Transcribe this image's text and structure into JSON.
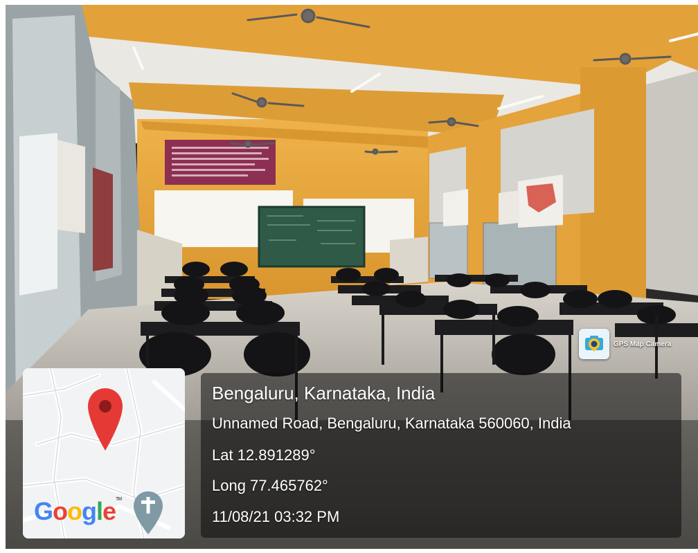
{
  "photo": {
    "subject": "classroom-with-desks-chairs-chalkboard",
    "colors": {
      "wall": "#e8a63a",
      "ceiling": "#ecebe6",
      "chalkboard": "#2f5a48",
      "furniture": "#1b1b1d",
      "floor": "#bdb7ad"
    },
    "poster_text_illegible": true
  },
  "stamp": {
    "app_name": "GPS Map Camera",
    "logo_icon": "camera-lens-pin-icon"
  },
  "map": {
    "brand": "Google",
    "pin_icon": "map-pin-icon",
    "place_icon": "cross-marker-icon",
    "pin_color": "#e53935"
  },
  "location": {
    "place": "Bengaluru, Karnataka, India",
    "address": "Unnamed Road, Bengaluru, Karnataka 560060, India",
    "latitude": "Lat 12.891289°",
    "longitude": "Long 77.465762°",
    "datetime": "11/08/21 03:32 PM"
  }
}
